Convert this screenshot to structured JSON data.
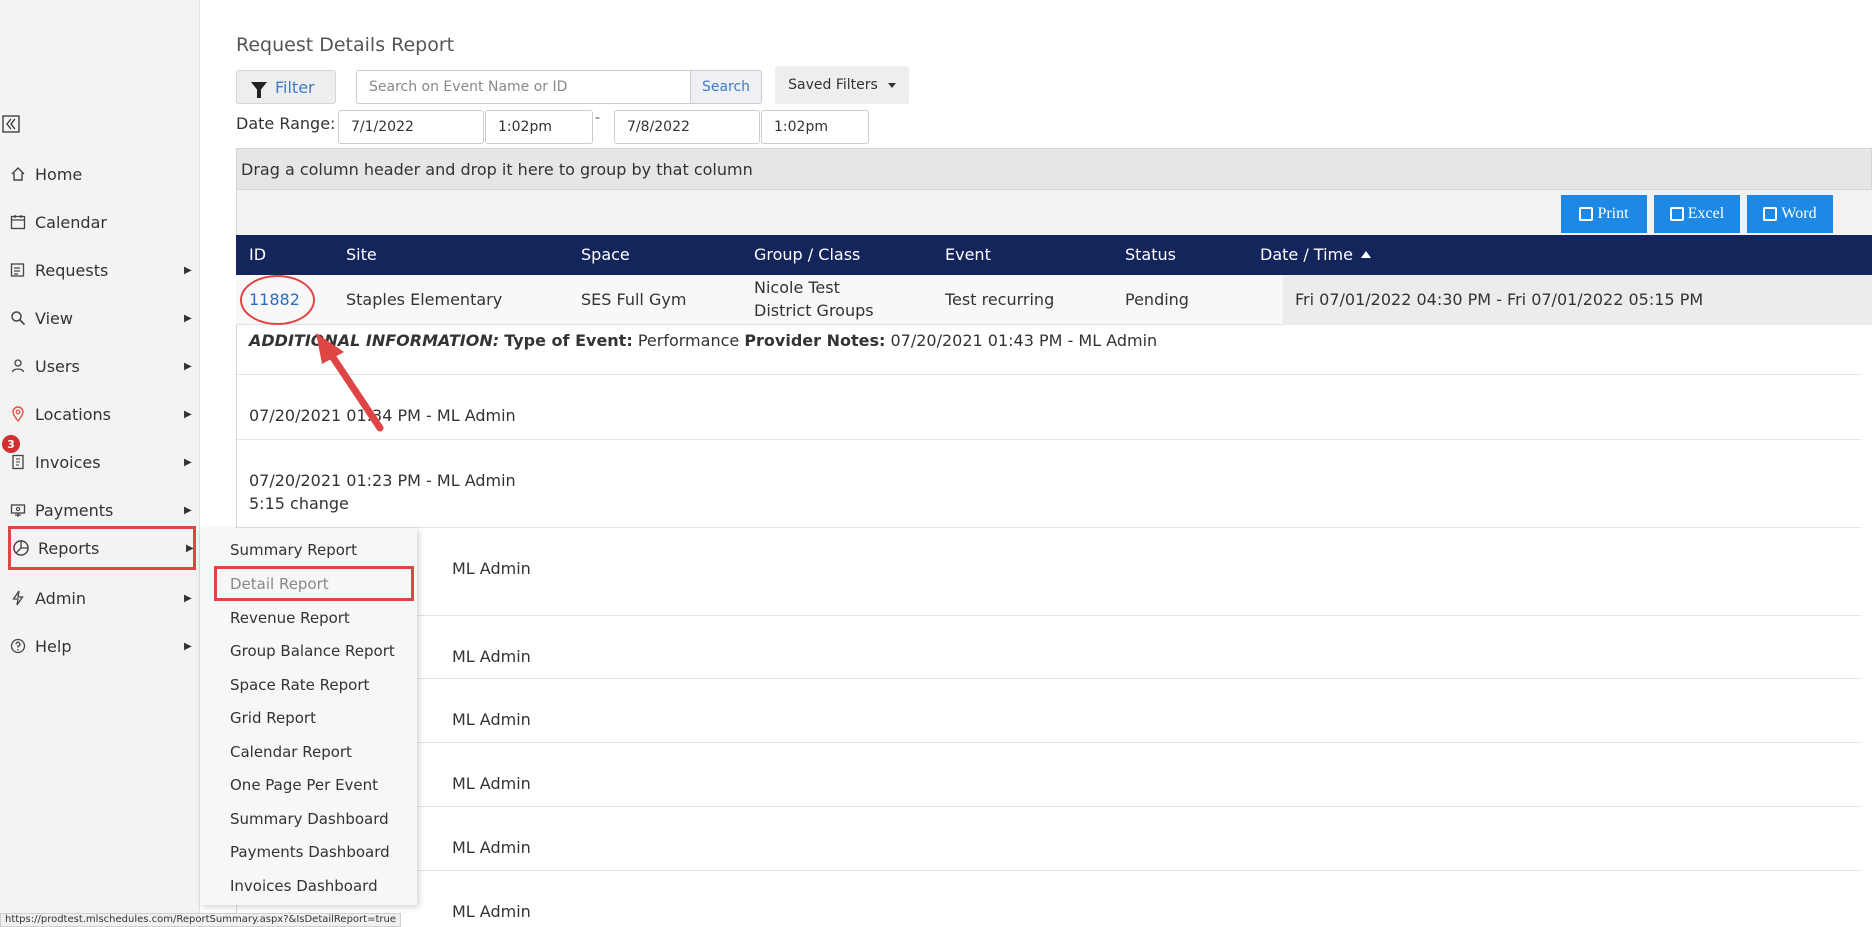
{
  "sidebar": {
    "items": [
      {
        "name": "home",
        "label": "Home",
        "icon": "home-icon",
        "has_submenu": false
      },
      {
        "name": "calendar",
        "label": "Calendar",
        "icon": "calendar-icon",
        "has_submenu": false
      },
      {
        "name": "requests",
        "label": "Requests",
        "icon": "requests-icon",
        "has_submenu": true
      },
      {
        "name": "view",
        "label": "View",
        "icon": "search-icon",
        "has_submenu": true
      },
      {
        "name": "users",
        "label": "Users",
        "icon": "users-icon",
        "has_submenu": true
      },
      {
        "name": "locations",
        "label": "Locations",
        "icon": "location-pin-icon",
        "has_submenu": true
      },
      {
        "name": "invoices",
        "label": "Invoices",
        "icon": "invoice-icon",
        "has_submenu": true
      },
      {
        "name": "payments",
        "label": "Payments",
        "icon": "payments-icon",
        "has_submenu": true
      },
      {
        "name": "reports",
        "label": "Reports",
        "icon": "reports-icon",
        "has_submenu": true
      },
      {
        "name": "admin",
        "label": "Admin",
        "icon": "bolt-icon",
        "has_submenu": true
      },
      {
        "name": "help",
        "label": "Help",
        "icon": "help-icon",
        "has_submenu": true
      }
    ],
    "invoices_badge": "3"
  },
  "reports_menu": {
    "items": [
      {
        "label": "Summary Report"
      },
      {
        "label": "Detail Report",
        "active": true
      },
      {
        "label": "Revenue Report"
      },
      {
        "label": "Group Balance Report"
      },
      {
        "label": "Space Rate Report"
      },
      {
        "label": "Grid Report"
      },
      {
        "label": "Calendar Report"
      },
      {
        "label": "One Page Per Event"
      },
      {
        "label": "Summary Dashboard"
      },
      {
        "label": "Payments Dashboard"
      },
      {
        "label": "Invoices Dashboard"
      }
    ]
  },
  "page": {
    "title": "Request Details Report",
    "filter_label": "Filter",
    "search_placeholder": "Search on Event Name or ID",
    "search_button": "Search",
    "saved_filters": "Saved Filters",
    "date_range_label": "Date Range:",
    "start_date": "7/1/2022",
    "start_time": "1:02pm",
    "end_date": "7/8/2022",
    "end_time": "1:02pm",
    "date_separator": "-"
  },
  "grid": {
    "group_hint": "Drag a column header and drop it here to group by that column",
    "export": {
      "print": "Print",
      "excel": "Excel",
      "word": "Word"
    },
    "columns": [
      "ID",
      "Site",
      "Space",
      "Group / Class",
      "Event",
      "Status",
      "Date / Time"
    ],
    "sorted_column": "Date / Time",
    "sort_direction": "ascending",
    "row": {
      "id": "11882",
      "site": "Staples Elementary",
      "space": "SES Full Gym",
      "group_line1": "Nicole Test",
      "group_line2": "District Groups",
      "event": "Test recurring",
      "status": "Pending",
      "datetime": "Fri 07/01/2022 04:30 PM - Fri 07/01/2022 05:15 PM"
    },
    "additional_info": {
      "heading": "ADDITIONAL INFORMATION:",
      "type_label": "Type of Event:",
      "type_value": "Performance",
      "notes_label": "Provider Notes:",
      "notes_value": "07/20/2021 01:43 PM - ML Admin"
    },
    "notes": [
      {
        "line1": "07/20/2021 01:34 PM - ML Admin",
        "line2": ""
      },
      {
        "line1": "07/20/2021 01:23 PM - ML Admin",
        "line2": "5:15 change"
      },
      {
        "line1": "ML Admin",
        "line2": ""
      },
      {
        "line1": "ML Admin",
        "line2": ""
      },
      {
        "line1": "ML Admin",
        "line2": ""
      },
      {
        "line1": "ML Admin",
        "line2": ""
      },
      {
        "line1": "ML Admin",
        "line2": ""
      },
      {
        "line1": "ML Admin",
        "line2": ""
      }
    ]
  },
  "status_bar": {
    "url": "https://prodtest.mlschedules.com/ReportSummary.aspx?&IsDetailReport=true"
  },
  "colors": {
    "header_bg": "#14255c",
    "export_btn": "#1e88e5",
    "highlight": "#e04545",
    "link": "#2a6ebb"
  }
}
